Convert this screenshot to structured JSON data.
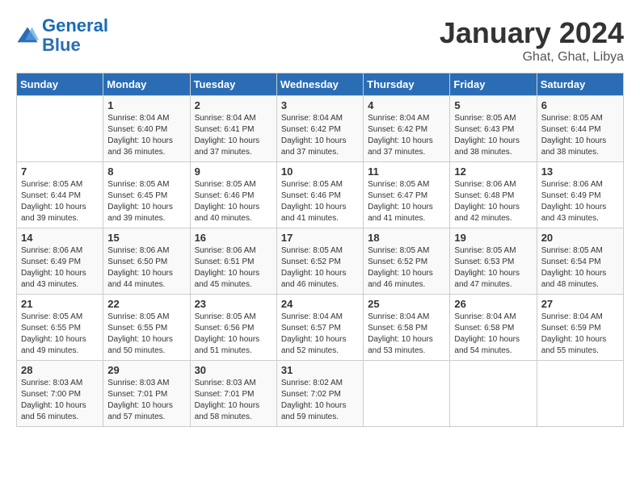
{
  "header": {
    "logo_line1": "General",
    "logo_line2": "Blue",
    "title": "January 2024",
    "subtitle": "Ghat, Ghat, Libya"
  },
  "weekdays": [
    "Sunday",
    "Monday",
    "Tuesday",
    "Wednesday",
    "Thursday",
    "Friday",
    "Saturday"
  ],
  "weeks": [
    [
      {
        "day": "",
        "info": ""
      },
      {
        "day": "1",
        "info": "Sunrise: 8:04 AM\nSunset: 6:40 PM\nDaylight: 10 hours\nand 36 minutes."
      },
      {
        "day": "2",
        "info": "Sunrise: 8:04 AM\nSunset: 6:41 PM\nDaylight: 10 hours\nand 37 minutes."
      },
      {
        "day": "3",
        "info": "Sunrise: 8:04 AM\nSunset: 6:42 PM\nDaylight: 10 hours\nand 37 minutes."
      },
      {
        "day": "4",
        "info": "Sunrise: 8:04 AM\nSunset: 6:42 PM\nDaylight: 10 hours\nand 37 minutes."
      },
      {
        "day": "5",
        "info": "Sunrise: 8:05 AM\nSunset: 6:43 PM\nDaylight: 10 hours\nand 38 minutes."
      },
      {
        "day": "6",
        "info": "Sunrise: 8:05 AM\nSunset: 6:44 PM\nDaylight: 10 hours\nand 38 minutes."
      }
    ],
    [
      {
        "day": "7",
        "info": "Sunrise: 8:05 AM\nSunset: 6:44 PM\nDaylight: 10 hours\nand 39 minutes."
      },
      {
        "day": "8",
        "info": "Sunrise: 8:05 AM\nSunset: 6:45 PM\nDaylight: 10 hours\nand 39 minutes."
      },
      {
        "day": "9",
        "info": "Sunrise: 8:05 AM\nSunset: 6:46 PM\nDaylight: 10 hours\nand 40 minutes."
      },
      {
        "day": "10",
        "info": "Sunrise: 8:05 AM\nSunset: 6:46 PM\nDaylight: 10 hours\nand 41 minutes."
      },
      {
        "day": "11",
        "info": "Sunrise: 8:05 AM\nSunset: 6:47 PM\nDaylight: 10 hours\nand 41 minutes."
      },
      {
        "day": "12",
        "info": "Sunrise: 8:06 AM\nSunset: 6:48 PM\nDaylight: 10 hours\nand 42 minutes."
      },
      {
        "day": "13",
        "info": "Sunrise: 8:06 AM\nSunset: 6:49 PM\nDaylight: 10 hours\nand 43 minutes."
      }
    ],
    [
      {
        "day": "14",
        "info": "Sunrise: 8:06 AM\nSunset: 6:49 PM\nDaylight: 10 hours\nand 43 minutes."
      },
      {
        "day": "15",
        "info": "Sunrise: 8:06 AM\nSunset: 6:50 PM\nDaylight: 10 hours\nand 44 minutes."
      },
      {
        "day": "16",
        "info": "Sunrise: 8:06 AM\nSunset: 6:51 PM\nDaylight: 10 hours\nand 45 minutes."
      },
      {
        "day": "17",
        "info": "Sunrise: 8:05 AM\nSunset: 6:52 PM\nDaylight: 10 hours\nand 46 minutes."
      },
      {
        "day": "18",
        "info": "Sunrise: 8:05 AM\nSunset: 6:52 PM\nDaylight: 10 hours\nand 46 minutes."
      },
      {
        "day": "19",
        "info": "Sunrise: 8:05 AM\nSunset: 6:53 PM\nDaylight: 10 hours\nand 47 minutes."
      },
      {
        "day": "20",
        "info": "Sunrise: 8:05 AM\nSunset: 6:54 PM\nDaylight: 10 hours\nand 48 minutes."
      }
    ],
    [
      {
        "day": "21",
        "info": "Sunrise: 8:05 AM\nSunset: 6:55 PM\nDaylight: 10 hours\nand 49 minutes."
      },
      {
        "day": "22",
        "info": "Sunrise: 8:05 AM\nSunset: 6:55 PM\nDaylight: 10 hours\nand 50 minutes."
      },
      {
        "day": "23",
        "info": "Sunrise: 8:05 AM\nSunset: 6:56 PM\nDaylight: 10 hours\nand 51 minutes."
      },
      {
        "day": "24",
        "info": "Sunrise: 8:04 AM\nSunset: 6:57 PM\nDaylight: 10 hours\nand 52 minutes."
      },
      {
        "day": "25",
        "info": "Sunrise: 8:04 AM\nSunset: 6:58 PM\nDaylight: 10 hours\nand 53 minutes."
      },
      {
        "day": "26",
        "info": "Sunrise: 8:04 AM\nSunset: 6:58 PM\nDaylight: 10 hours\nand 54 minutes."
      },
      {
        "day": "27",
        "info": "Sunrise: 8:04 AM\nSunset: 6:59 PM\nDaylight: 10 hours\nand 55 minutes."
      }
    ],
    [
      {
        "day": "28",
        "info": "Sunrise: 8:03 AM\nSunset: 7:00 PM\nDaylight: 10 hours\nand 56 minutes."
      },
      {
        "day": "29",
        "info": "Sunrise: 8:03 AM\nSunset: 7:01 PM\nDaylight: 10 hours\nand 57 minutes."
      },
      {
        "day": "30",
        "info": "Sunrise: 8:03 AM\nSunset: 7:01 PM\nDaylight: 10 hours\nand 58 minutes."
      },
      {
        "day": "31",
        "info": "Sunrise: 8:02 AM\nSunset: 7:02 PM\nDaylight: 10 hours\nand 59 minutes."
      },
      {
        "day": "",
        "info": ""
      },
      {
        "day": "",
        "info": ""
      },
      {
        "day": "",
        "info": ""
      }
    ]
  ]
}
